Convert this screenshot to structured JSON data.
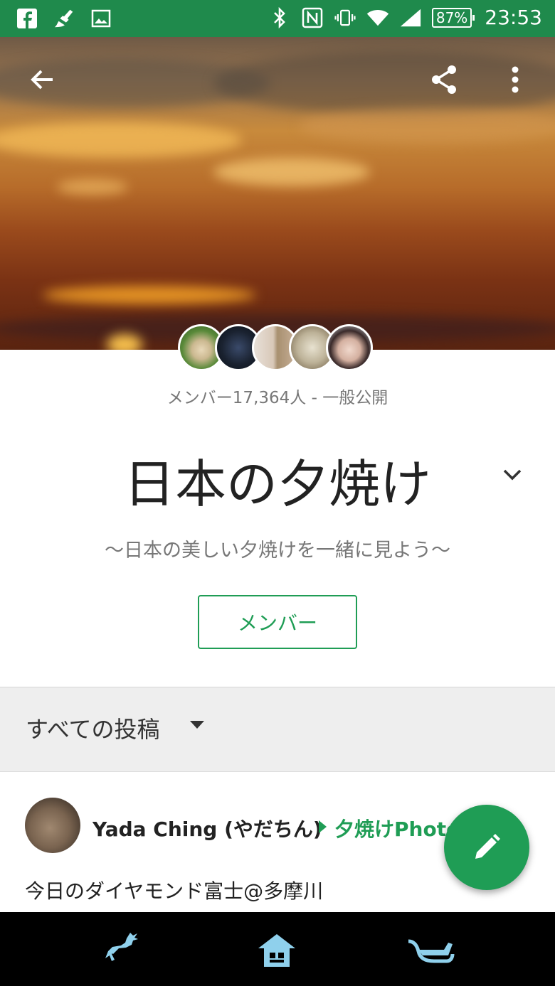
{
  "status_bar": {
    "battery": "87%",
    "time": "23:53",
    "left_icons": [
      "facebook-icon",
      "broom-icon",
      "image-icon"
    ],
    "right_icons": [
      "bluetooth-icon",
      "nfc-icon",
      "vibrate-icon",
      "wifi-icon",
      "signal-icon",
      "battery-icon"
    ]
  },
  "header": {
    "back_icon": "arrow-back-icon",
    "share_icon": "share-icon",
    "more_icon": "more-vert-icon"
  },
  "group": {
    "meta": "メンバー17,364人 - 一般公開",
    "title": "日本の夕焼け",
    "subtitle": "～日本の美しい夕焼けを一緒に見よう～",
    "member_button": "メンバー"
  },
  "filter": {
    "label": "すべての投稿"
  },
  "post": {
    "author": "Yada Ching (やだちん)",
    "group": "夕焼けPhoto",
    "text": "今日のダイヤモンド富士@多摩川"
  },
  "fab_icon": "pencil-icon",
  "nav": {
    "items": [
      "deer-icon",
      "house-icon",
      "sleigh-icon"
    ]
  },
  "colors": {
    "status_bar": "#1f8a4c",
    "accent": "#1f9d55",
    "nav_icon": "#8fd0ec"
  }
}
